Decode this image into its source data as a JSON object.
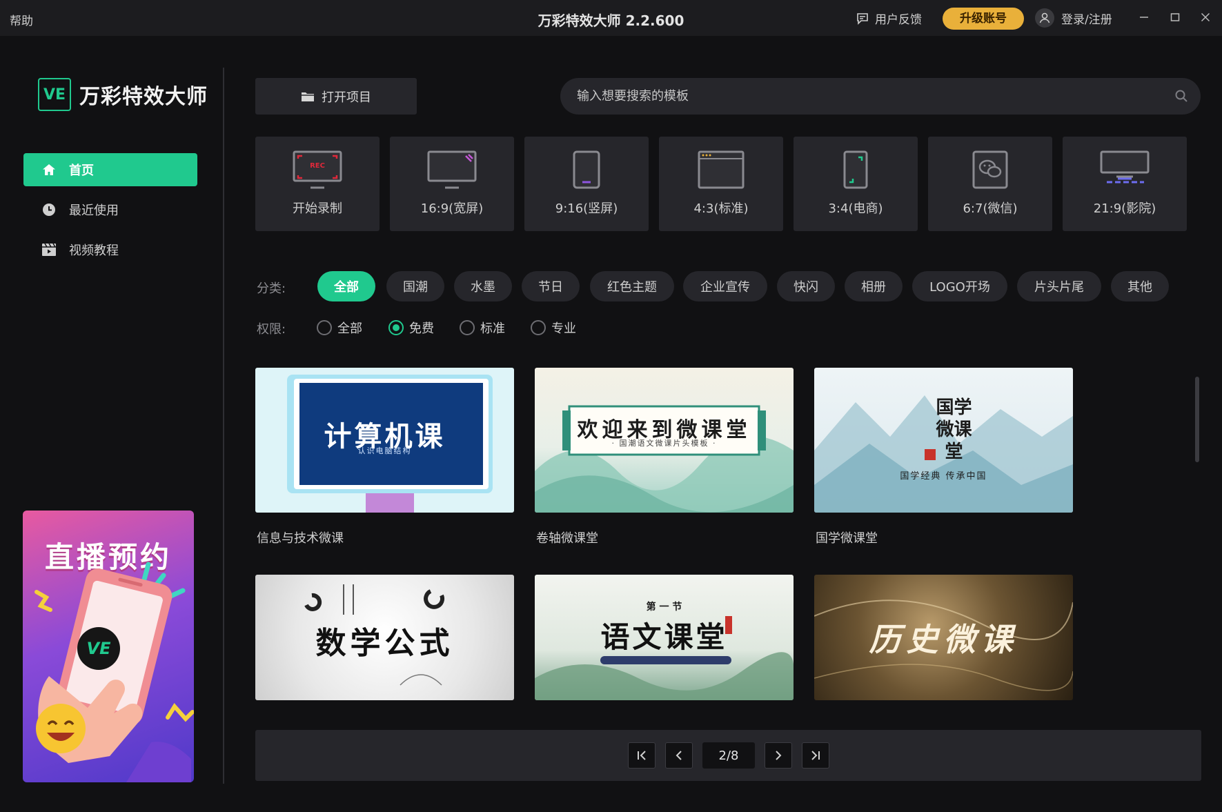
{
  "titlebar": {
    "help": "帮助",
    "title": "万彩特效大师 2.2.600",
    "feedback": "用户反馈",
    "upgrade": "升级账号",
    "login": "登录/注册"
  },
  "sidebar": {
    "logo_badge": "VE",
    "logo_name": "万彩特效大师",
    "items": [
      {
        "label": "首页",
        "icon": "home-icon"
      },
      {
        "label": "最近使用",
        "icon": "clock-icon"
      },
      {
        "label": "视频教程",
        "icon": "video-icon"
      }
    ],
    "promo": {
      "title": "直播预约",
      "badge": "VE"
    }
  },
  "toolbar": {
    "open_project": "打开项目",
    "search_placeholder": "输入想要搜索的模板"
  },
  "ratios": [
    {
      "label": "开始录制",
      "rec": "REC"
    },
    {
      "label": "16:9(宽屏)"
    },
    {
      "label": "9:16(竖屏)"
    },
    {
      "label": "4:3(标准)"
    },
    {
      "label": "3:4(电商)"
    },
    {
      "label": "6:7(微信)"
    },
    {
      "label": "21:9(影院)"
    }
  ],
  "filters": {
    "category_label": "分类:",
    "categories": [
      "全部",
      "国潮",
      "水墨",
      "节日",
      "红色主题",
      "企业宣传",
      "快闪",
      "相册",
      "LOGO开场",
      "片头片尾",
      "其他"
    ],
    "permission_label": "权限:",
    "permissions": [
      "全部",
      "免费",
      "标准",
      "专业"
    ]
  },
  "templates": [
    {
      "label": "信息与技术微课",
      "art": "计算机课",
      "sub": "认识电脑结构"
    },
    {
      "label": "卷轴微课堂",
      "art": "欢迎来到微课堂",
      "sub": "· 国潮语文微课片头模板 ·"
    },
    {
      "label": "国学微课堂",
      "art": "国学微课堂",
      "sub": "国学经典  传承中国"
    },
    {
      "label": "",
      "art": "数学公式"
    },
    {
      "label": "",
      "art": "语文课堂",
      "sub": "第 一 节"
    },
    {
      "label": "",
      "art": "历史微课"
    }
  ],
  "pager": {
    "page": "2/8"
  },
  "colors": {
    "accent": "#20c98e",
    "upgrade": "#e9b03a",
    "bg": "#111113",
    "panel": "#26262b"
  }
}
